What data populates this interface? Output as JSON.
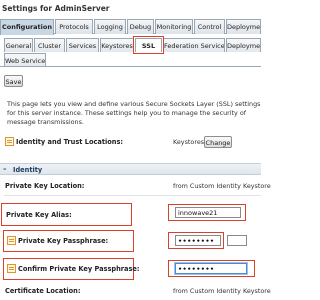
{
  "window": {
    "title": "Settings for AdminServer"
  },
  "primary_tabs": [
    {
      "label": "Configuration",
      "active": true
    },
    {
      "label": "Protocols"
    },
    {
      "label": "Logging"
    },
    {
      "label": "Debug"
    },
    {
      "label": "Monitoring"
    },
    {
      "label": "Control"
    },
    {
      "label": "Deployments"
    }
  ],
  "secondary_tabs_row1": [
    {
      "label": "General"
    },
    {
      "label": "Cluster"
    },
    {
      "label": "Services"
    },
    {
      "label": "Keystores"
    },
    {
      "label": "SSL",
      "active": true
    },
    {
      "label": "Federation Services"
    },
    {
      "label": "Deployment"
    }
  ],
  "secondary_tabs_row2": [
    {
      "label": "Web Services"
    }
  ],
  "save_button": "Save",
  "description": "This page lets you view and define various Secure Sockets Layer (SSL) settings for this server instance. These settings help you to manage the security of message transmissions.",
  "identity_trust": {
    "label": "Identity and Trust Locations:",
    "value": "Keystores",
    "change_button": "Change"
  },
  "identity_section": {
    "title": "Identity",
    "collapse_symbol": "–"
  },
  "private_key_location": {
    "label": "Private Key Location:",
    "value": "from Custom Identity Keystore"
  },
  "private_key_alias": {
    "label": "Private Key Alias:",
    "value": "innowave21"
  },
  "private_key_passphrase": {
    "label": "Private Key Passphrase:",
    "value": "••••••••"
  },
  "confirm_passphrase": {
    "label": "Confirm Private Key Passphrase:",
    "value": "••••••••"
  },
  "certificate_location": {
    "label": "Certificate Location:",
    "value": "from Custom Identity Keystore"
  },
  "colors": {
    "highlight_red": "#d9412b",
    "tab_border": "#9aa7b4",
    "section_text": "#1f3e63",
    "icon_orange": "#e0962c"
  }
}
